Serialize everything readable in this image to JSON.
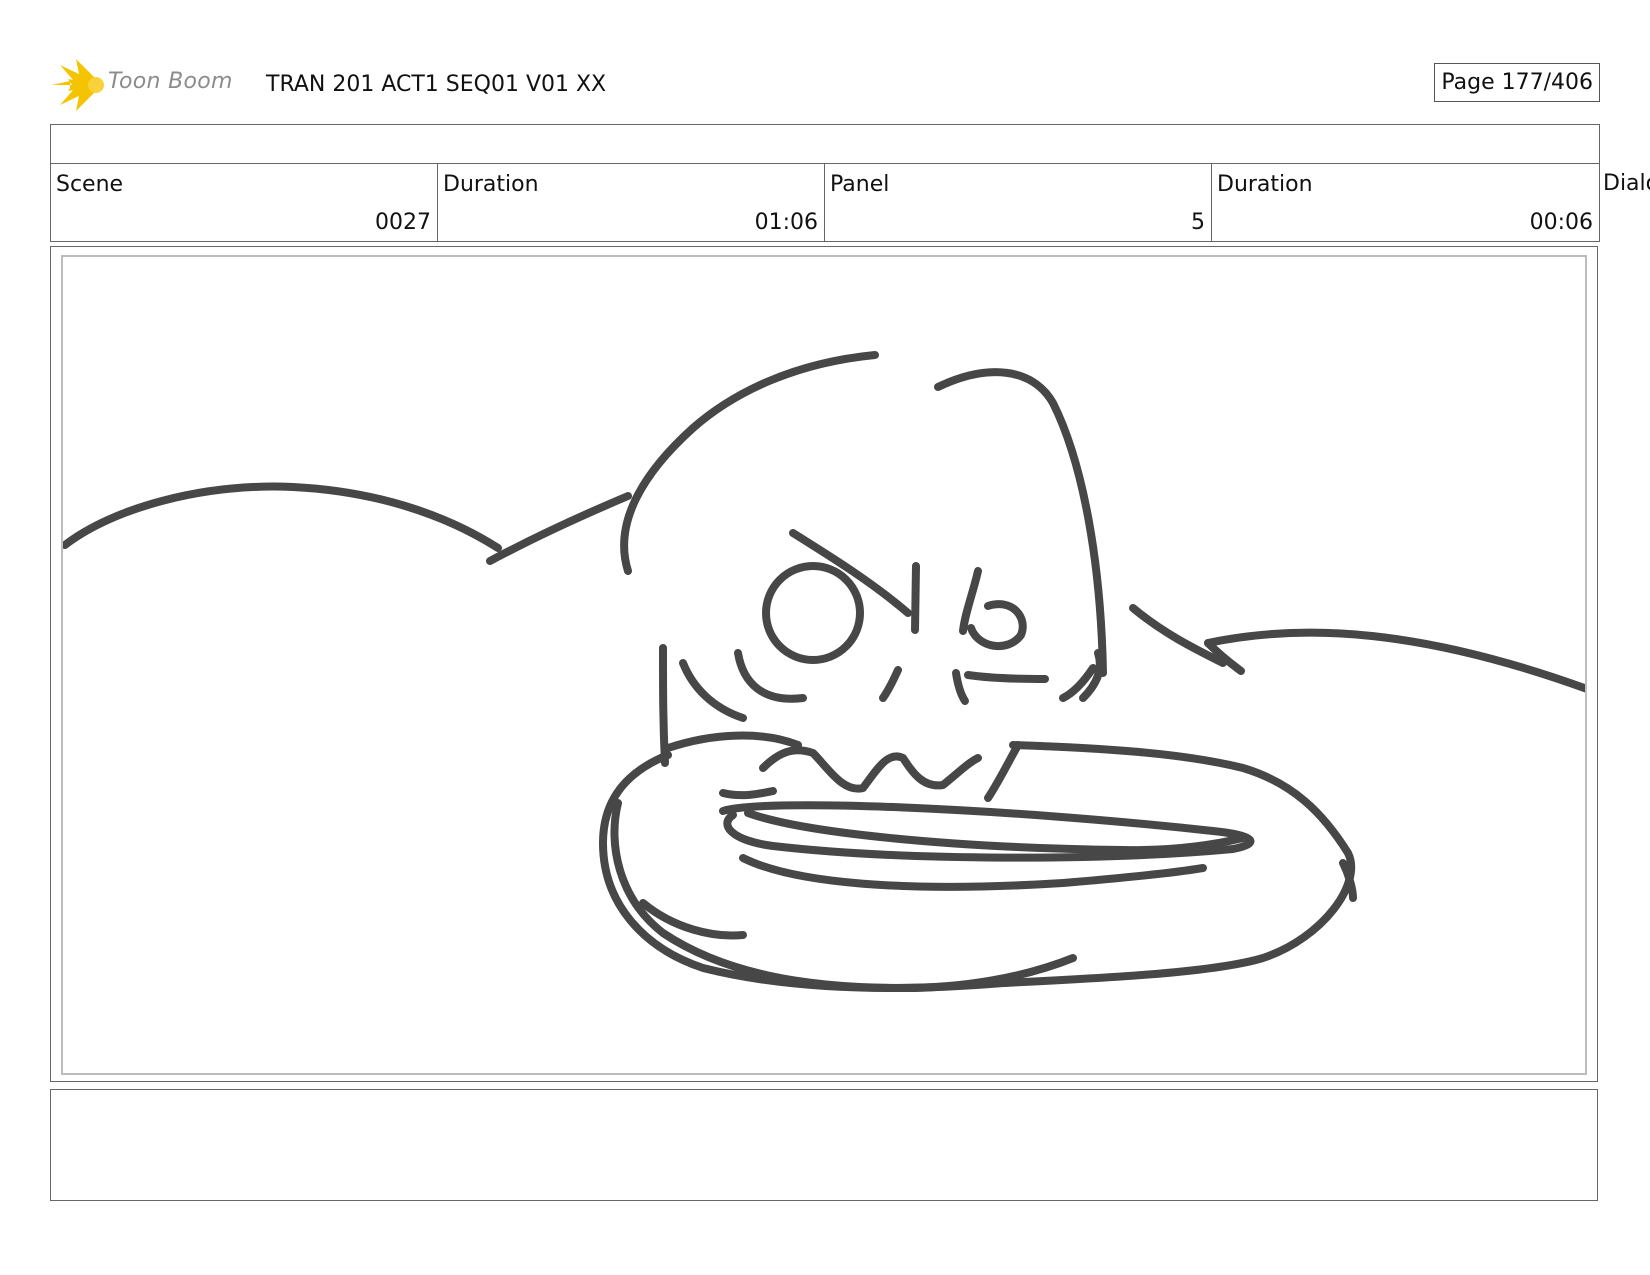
{
  "header": {
    "logo_text": "Toon Boom",
    "title": "TRAN 201 ACT1 SEQ01 V01 XX",
    "page_label": "Page 177/406"
  },
  "info": {
    "scene_label": "Scene",
    "scene_value": "0027",
    "scene_duration_label": "Duration",
    "scene_duration_value": "01:06",
    "panel_label": "Panel",
    "panel_value": "5",
    "panel_duration_label": "Duration",
    "panel_duration_value": "00:06",
    "dialog_label": "Dialog"
  },
  "colors": {
    "sketch_stroke": "#474747",
    "logo_yellow": "#f5c400",
    "frame_border": "#666666"
  },
  "icons": {
    "logo": "toon-boom-starburst-icon"
  }
}
